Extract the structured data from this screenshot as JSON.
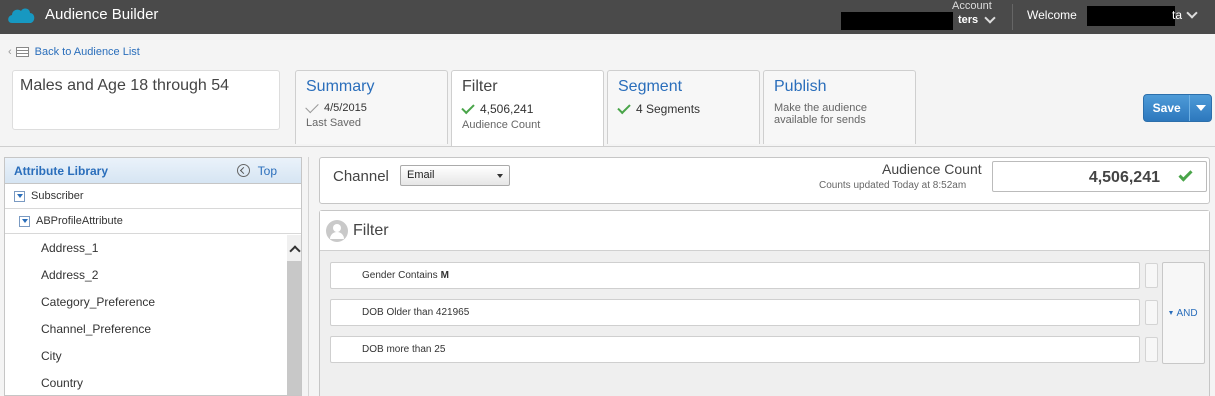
{
  "header": {
    "app_title": "Audience Builder",
    "account_label": "Account",
    "account_value_suffix": "ters",
    "welcome_label": "Welcome",
    "welcome_suffix": "ta"
  },
  "nav": {
    "back_label": "Back to Audience List"
  },
  "audience": {
    "name": "Males and Age 18 through 54"
  },
  "tabs": [
    {
      "title": "Summary",
      "line": "4/5/2015",
      "sub": "Last Saved",
      "state": "saved"
    },
    {
      "title": "Filter",
      "line": "4,506,241",
      "sub": "Audience Count",
      "state": "active"
    },
    {
      "title": "Segment",
      "line": "4 Segments",
      "sub": "",
      "state": "done"
    },
    {
      "title": "Publish",
      "line": "",
      "sub": "Make the audience available for sends",
      "state": "pending"
    }
  ],
  "toolbar": {
    "save_label": "Save"
  },
  "library": {
    "title": "Attribute Library",
    "top_label": "Top",
    "groups": [
      "Subscriber",
      "ABProfileAttribute"
    ],
    "attributes": [
      "Address_1",
      "Address_2",
      "Category_Preference",
      "Channel_Preference",
      "City",
      "Country"
    ]
  },
  "channel": {
    "label": "Channel",
    "selected": "Email",
    "audience_count_label": "Audience Count",
    "updated_text": "Counts updated Today at 8:52am",
    "audience_count_value": "4,506,241"
  },
  "filter": {
    "title": "Filter",
    "rules": [
      {
        "text": "Gender  Contains",
        "value": "M"
      },
      {
        "text": "DOB Older than 421965",
        "value": ""
      },
      {
        "text": "DOB more than 25",
        "value": ""
      }
    ],
    "operator": "AND"
  },
  "colors": {
    "topbar": "#4a4a4a",
    "link": "#2a6ebb",
    "check": "#4aa54a",
    "save": "#2d78bd"
  }
}
